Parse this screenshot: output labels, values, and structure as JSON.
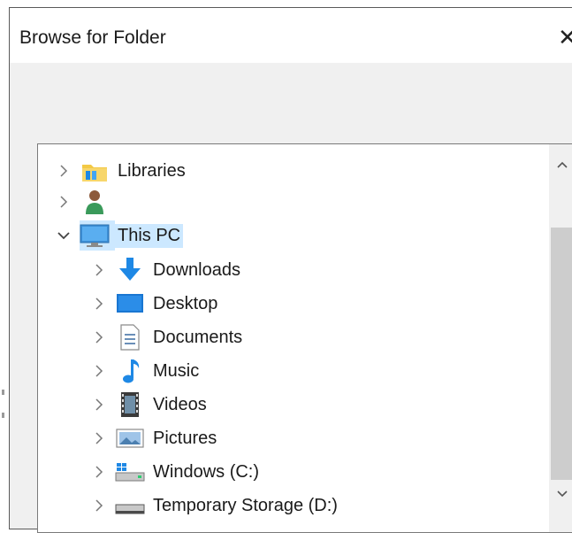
{
  "dialog": {
    "title": "Browse for Folder",
    "close_glyph": "✕"
  },
  "tree": {
    "items": [
      {
        "label": "Libraries",
        "icon": "libraries-folder-icon",
        "expanded": false,
        "level": 0
      },
      {
        "label": "",
        "icon": "user-icon",
        "expanded": false,
        "level": 0
      },
      {
        "label": "This PC",
        "icon": "this-pc-icon",
        "expanded": true,
        "level": 0,
        "selected": true
      },
      {
        "label": "Downloads",
        "icon": "downloads-icon",
        "expanded": false,
        "level": 1
      },
      {
        "label": "Desktop",
        "icon": "desktop-icon",
        "expanded": false,
        "level": 1
      },
      {
        "label": "Documents",
        "icon": "documents-icon",
        "expanded": false,
        "level": 1
      },
      {
        "label": "Music",
        "icon": "music-icon",
        "expanded": false,
        "level": 1
      },
      {
        "label": "Videos",
        "icon": "videos-icon",
        "expanded": false,
        "level": 1
      },
      {
        "label": "Pictures",
        "icon": "pictures-icon",
        "expanded": false,
        "level": 1
      },
      {
        "label": "Windows (C:)",
        "icon": "windows-drive-icon",
        "expanded": false,
        "level": 1
      },
      {
        "label": "Temporary Storage (D:)",
        "icon": "drive-icon",
        "expanded": false,
        "level": 1
      }
    ]
  },
  "colors": {
    "selection": "#cce8ff",
    "folder": "#f3c945",
    "accent": "#1e88e5"
  }
}
